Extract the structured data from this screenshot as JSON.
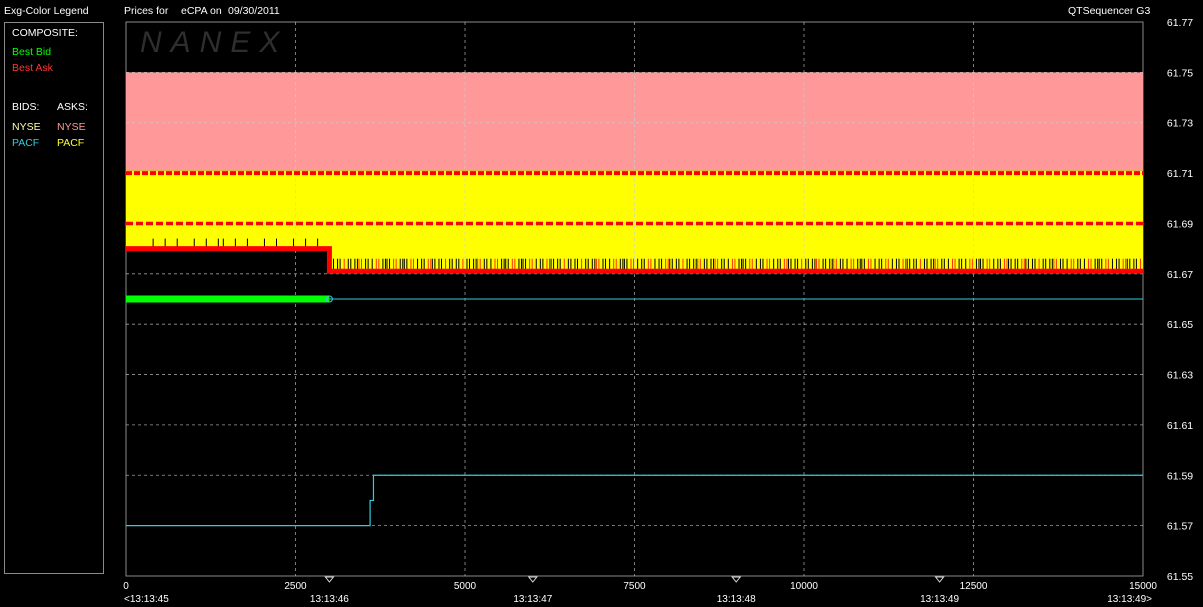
{
  "header": {
    "legend_title": "Exg-Color Legend",
    "prices_label": "Prices for",
    "symbol": "eCPA",
    "on_label": "on",
    "date": "09/30/2011",
    "app_name": "QTSequencer G3"
  },
  "watermark": "NANEX",
  "legend": {
    "composite_label": "COMPOSITE:",
    "best_bid": "Best Bid",
    "best_ask": "Best Ask",
    "bids_label": "BIDS:",
    "asks_label": "ASKS:",
    "bids": [
      {
        "name": "NYSE",
        "color": "#ffffaa"
      },
      {
        "name": "PACF",
        "color": "#33ccdd"
      }
    ],
    "asks": [
      {
        "name": "NYSE",
        "color": "#ff9999"
      },
      {
        "name": "PACF",
        "color": "#ffff33"
      }
    ]
  },
  "colors": {
    "best_bid": "#00ff00",
    "best_ask": "#ff0000",
    "nyse_ask_fill": "#ff9999",
    "pacf_ask_fill": "#ffff00",
    "pacf_bid": "#33ccdd",
    "grid": "#cfcfcf"
  },
  "chart_data": {
    "type": "line",
    "xlim": [
      0,
      15000
    ],
    "ylim": [
      61.55,
      61.77
    ],
    "x_ticks": [
      0,
      2500,
      5000,
      7500,
      10000,
      12500,
      15000
    ],
    "y_ticks": [
      61.55,
      61.57,
      61.59,
      61.61,
      61.63,
      61.65,
      61.67,
      61.69,
      61.71,
      61.73,
      61.75,
      61.77
    ],
    "y_tick_labels": [
      "61.55",
      "61.57",
      "61.59",
      "61.61",
      "61.63",
      "61.65",
      "61.67",
      "61.69",
      "61.71",
      "61.73",
      "61.75",
      "61.77"
    ],
    "time_ticks": [
      {
        "x": 0,
        "label": "<13:13:45"
      },
      {
        "x": 3000,
        "label": "13:13:46"
      },
      {
        "x": 6000,
        "label": "13:13:47"
      },
      {
        "x": 9000,
        "label": "13:13:48"
      },
      {
        "x": 12000,
        "label": "13:13:49"
      },
      {
        "x": 15000,
        "label": "13:13:49>"
      }
    ],
    "grid": true,
    "series": [
      {
        "name": "NYSE",
        "side": "ask",
        "x": [
          0,
          15000
        ],
        "y_low": 61.711,
        "y_high": 61.75
      },
      {
        "name": "PACF",
        "side": "ask",
        "x": [
          0,
          3000,
          3000,
          15000
        ],
        "y_low": [
          61.68,
          61.68,
          61.671,
          61.671
        ],
        "y_high": 61.711
      },
      {
        "name": "Best Ask",
        "x": [
          0,
          15000
        ],
        "y": [
          61.71,
          61.71
        ]
      },
      {
        "name": "Best Ask",
        "x": [
          0,
          15000
        ],
        "y": [
          61.69,
          61.69
        ]
      },
      {
        "name": "Best Ask",
        "x": [
          0,
          3000,
          3000,
          15000
        ],
        "y": [
          61.68,
          61.68,
          61.671,
          61.671
        ]
      },
      {
        "name": "Best Bid",
        "x": [
          0,
          3000
        ],
        "y": [
          61.66,
          61.66
        ]
      },
      {
        "name": "PACF",
        "side": "bid",
        "x": [
          3000,
          15000
        ],
        "y": [
          61.66,
          61.66
        ]
      },
      {
        "name": "PACF",
        "side": "bid",
        "x": [
          0,
          3600,
          3600,
          3650,
          3650,
          15000
        ],
        "y": [
          61.57,
          61.57,
          61.58,
          61.58,
          61.59,
          61.59
        ]
      }
    ]
  }
}
